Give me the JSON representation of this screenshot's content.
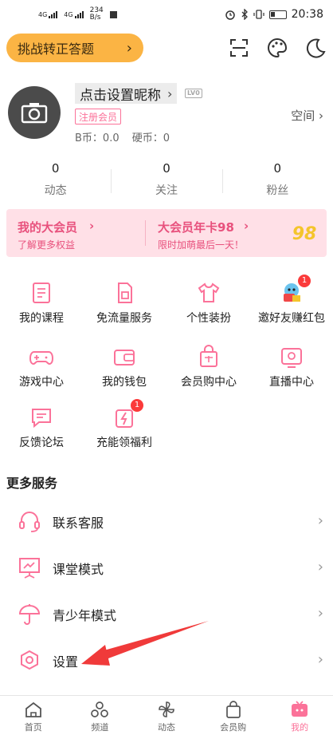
{
  "status_bar": {
    "net1": "4G",
    "net2": "4G",
    "speed_value": "234",
    "speed_unit": "B/s",
    "time": "20:38"
  },
  "header": {
    "challenge_label": "挑战转正答题",
    "icons": [
      "scan-icon",
      "palette-icon",
      "night-mode-icon"
    ]
  },
  "profile": {
    "nickname": "点击设置昵称",
    "level": "LV0",
    "register_badge": "注册会员",
    "b_coin": "B币：0.0",
    "hard_coin": "硬币：0",
    "space_label": "空间"
  },
  "stats": [
    {
      "num": "0",
      "label": "动态"
    },
    {
      "num": "0",
      "label": "关注"
    },
    {
      "num": "0",
      "label": "粉丝"
    }
  ],
  "vip": {
    "left_title": "我的大会员",
    "left_sub": "了解更多权益",
    "right_title": "大会员年卡98",
    "right_sub": "限时加萌最后一天！",
    "badge": "98"
  },
  "grid": [
    {
      "label": "我的课程",
      "icon": "course-icon"
    },
    {
      "label": "免流量服务",
      "icon": "sim-card-icon"
    },
    {
      "label": "个性装扮",
      "icon": "tshirt-icon"
    },
    {
      "label": "邀好友赚红包",
      "icon": "invite-mascot-icon",
      "badge": "1"
    },
    {
      "label": "游戏中心",
      "icon": "gamepad-icon"
    },
    {
      "label": "我的钱包",
      "icon": "wallet-icon"
    },
    {
      "label": "会员购中心",
      "icon": "shopping-bag-icon"
    },
    {
      "label": "直播中心",
      "icon": "live-tv-icon"
    },
    {
      "label": "反馈论坛",
      "icon": "feedback-icon"
    },
    {
      "label": "充能领福利",
      "icon": "energy-gift-icon",
      "badge": "1"
    }
  ],
  "more": {
    "title": "更多服务",
    "items": [
      {
        "label": "联系客服",
        "icon": "headset-icon"
      },
      {
        "label": "课堂模式",
        "icon": "classroom-icon"
      },
      {
        "label": "青少年模式",
        "icon": "umbrella-icon"
      },
      {
        "label": "设置",
        "icon": "settings-hexagon-icon"
      }
    ]
  },
  "tabbar": [
    {
      "label": "首页",
      "icon": "home-icon"
    },
    {
      "label": "频道",
      "icon": "channel-icon"
    },
    {
      "label": "动态",
      "icon": "pinwheel-icon"
    },
    {
      "label": "会员购",
      "icon": "mall-bag-icon"
    },
    {
      "label": "我的",
      "icon": "profile-tv-icon",
      "active": true
    }
  ],
  "colors": {
    "accent_pink": "#fb7299",
    "challenge_yellow": "#fbb444",
    "vip_bg": "#ffe0e7",
    "annotation_arrow": "#f03a3a"
  }
}
